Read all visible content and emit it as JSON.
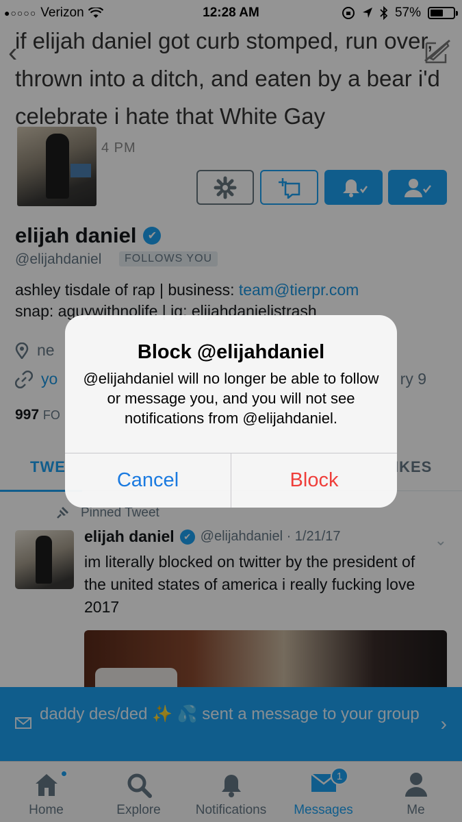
{
  "status_bar": {
    "signal": "●○○○○",
    "carrier": "Verizon",
    "time": "12:28 AM",
    "battery_percent": "57%",
    "battery_level": 0.57
  },
  "header": {
    "tweet_text": "if elijah daniel got curb stomped, run over, thrown into a ditch, and eaten by a bear i'd celebrate i hate that White Gay",
    "time_fragment": "4 PM"
  },
  "profile": {
    "name": "elijah daniel",
    "handle": "@elijahdaniel",
    "follows_you": "FOLLOWS YOU",
    "bio_prefix": "ashley tisdale of rap | business: ",
    "bio_link": "team@tierpr.com",
    "bio_line2": "snap: aguywithnolife | ig: elijahdanielistrash",
    "location_fragment": "ne",
    "website_fragment": "yo",
    "joined_fragment": "ry 9",
    "follow_count": "997",
    "follow_label_fragment": "FO"
  },
  "tabs": {
    "tweets_fragment": "TWE",
    "likes_fragment": "IKES"
  },
  "pinned_tweet": {
    "pinned_label": "Pinned Tweet",
    "name": "elijah daniel",
    "meta": "@elijahdaniel · 1/21/17",
    "text": "im literally blocked on twitter by the president of the united states of america i really fucking love 2017"
  },
  "banner": {
    "text": "daddy des/ded ✨ 💦  sent a message to your group"
  },
  "tab_bar": {
    "home": "Home",
    "explore": "Explore",
    "notifications": "Notifications",
    "messages": "Messages",
    "me": "Me",
    "messages_badge": "1"
  },
  "alert": {
    "title": "Block @elijahdaniel",
    "message": "@elijahdaniel will no longer be able to follow or message you, and you will not see notifications from @elijahdaniel.",
    "cancel_label": "Cancel",
    "block_label": "Block"
  },
  "colors": {
    "accent": "#1da1f2",
    "destructive": "#ef3e3a",
    "ios_blue": "#1a7ae0"
  }
}
